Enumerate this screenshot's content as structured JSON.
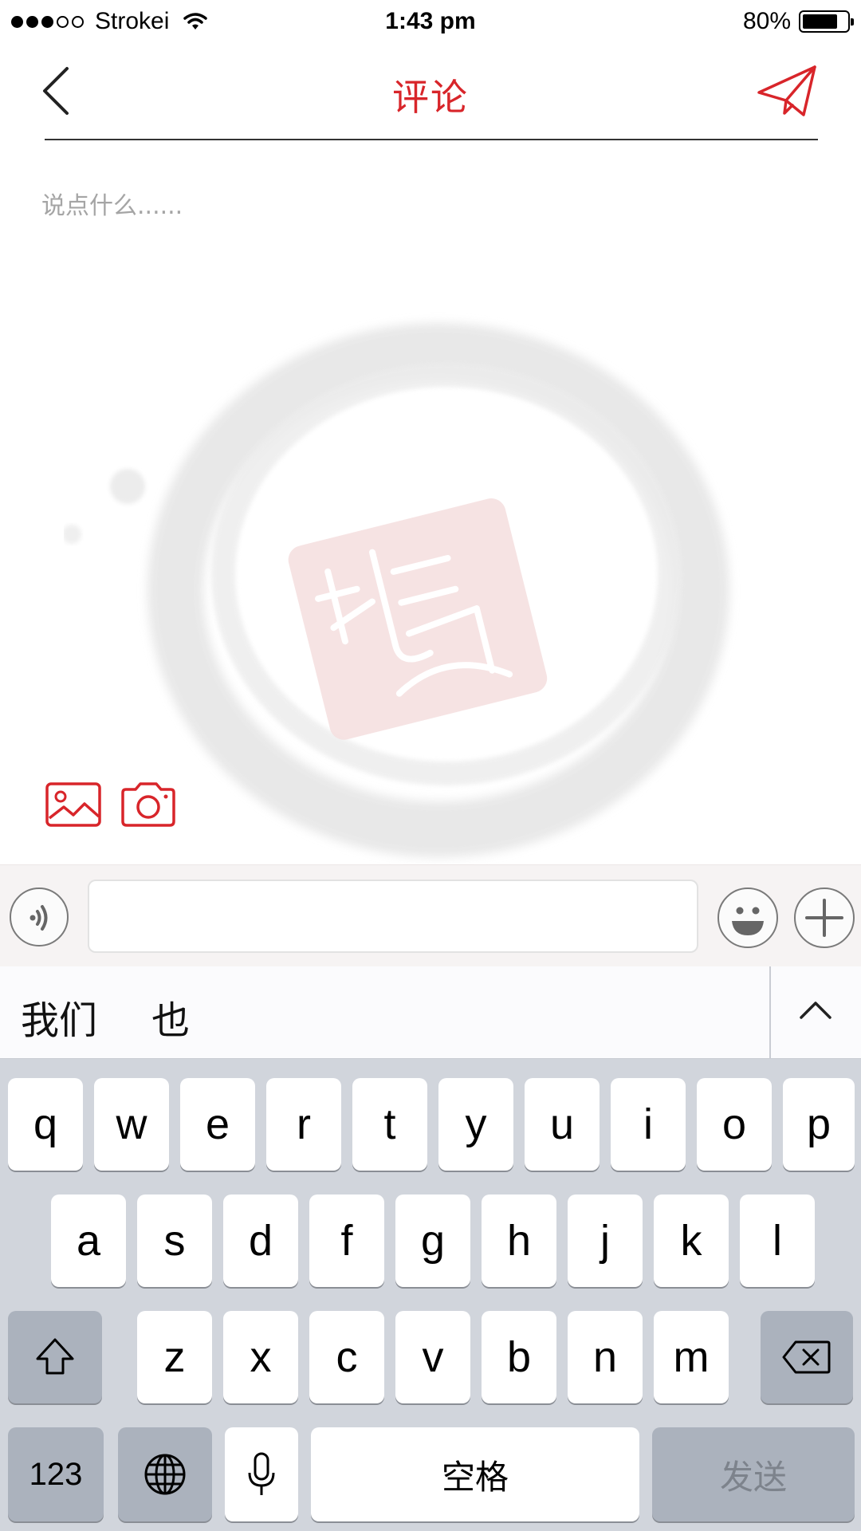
{
  "status_bar": {
    "carrier": "Strokei",
    "time": "1:43 pm",
    "battery": "80%",
    "battery_level": 0.8
  },
  "nav": {
    "title": "评论",
    "back_icon": "chevron-left-icon",
    "send_icon": "paper-plane-icon"
  },
  "comment": {
    "placeholder": "说点什么......",
    "value": ""
  },
  "media": {
    "image_icon": "image-icon",
    "camera_icon": "camera-icon"
  },
  "input_bar": {
    "voice_icon": "voice-icon",
    "emoji_icon": "smiley-icon",
    "plus_icon": "plus-icon"
  },
  "candidates": [
    "我们",
    "也"
  ],
  "keyboard": {
    "row1": [
      "q",
      "w",
      "e",
      "r",
      "t",
      "y",
      "u",
      "i",
      "o",
      "p"
    ],
    "row2": [
      "a",
      "s",
      "d",
      "f",
      "g",
      "h",
      "j",
      "k",
      "l"
    ],
    "row3": [
      "z",
      "x",
      "c",
      "v",
      "b",
      "n",
      "m"
    ],
    "numbers_key": "123",
    "space_key": "空格",
    "send_key": "发送"
  },
  "colors": {
    "accent": "#d8252a",
    "keyboard_bg": "#d1d5dc",
    "dark_key": "#abb2bd"
  }
}
